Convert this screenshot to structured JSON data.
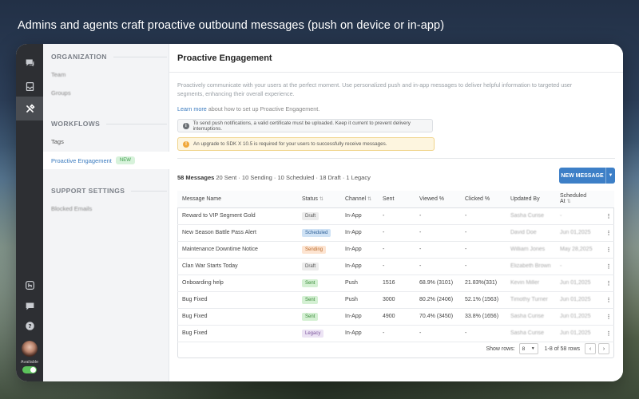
{
  "caption": "Admins and agents craft proactive outbound messages (push on device or in-app)",
  "rail": {
    "status_label": "Available"
  },
  "nav": {
    "organization_heading": "ORGANIZATION",
    "team": "Team",
    "groups": "Groups",
    "workflows_heading": "WORKFLOWS",
    "tags": "Tags",
    "proactive": "Proactive Engagement",
    "new_badge": "NEW",
    "support_heading": "SUPPORT SETTINGS",
    "blocked": "Blocked Emails"
  },
  "main": {
    "title": "Proactive Engagement",
    "intro": "Proactively communicate with your users at the perfect moment. Use personalized push and in-app messages to deliver helpful information to targeted user segments, enhancing their overall experience.",
    "learn_link": "Learn more",
    "learn_rest": " about how to set up Proactive Engagement.",
    "notice_info": "To send push notifications, a valid certificate must be uploaded. Keep it current to prevent delivery interruptions.",
    "notice_warn": "An upgrade to SDK X 10.5 is required for your users to successfully receive messages.",
    "summary_count": "58 Messages",
    "summary_rest": " 20 Sent · 10 Sending · 10 Scheduled · 18 Draft · 1 Legacy",
    "new_message": "NEW MESSAGE"
  },
  "table": {
    "headers": [
      "Message Name",
      "Status",
      "Channel",
      "Sent",
      "Viewed %",
      "Clicked %",
      "Updated By",
      "Scheduled At"
    ],
    "rows": [
      {
        "name": "Reward to VIP Segment Gold",
        "status": "Draft",
        "channel": "In-App",
        "sent": "-",
        "viewed": "-",
        "clicked": "-",
        "by": "Sasha Curise",
        "at": "-"
      },
      {
        "name": "New Season Battle Pass Alert",
        "status": "Scheduled",
        "channel": "In-App",
        "sent": "-",
        "viewed": "-",
        "clicked": "-",
        "by": "David Doe",
        "at": "Jun 01,2025"
      },
      {
        "name": "Maintenance Downtime Notice",
        "status": "Sending",
        "channel": "In-App",
        "sent": "-",
        "viewed": "-",
        "clicked": "-",
        "by": "William Jones",
        "at": "May 28,2025"
      },
      {
        "name": "Clan War Starts Today",
        "status": "Draft",
        "channel": "In-App",
        "sent": "-",
        "viewed": "-",
        "clicked": "-",
        "by": "Elizabeth Brown",
        "at": "-"
      },
      {
        "name": "Onboarding help",
        "status": "Sent",
        "channel": "Push",
        "sent": "1516",
        "viewed": "68.9% (3101)",
        "clicked": "21.83%(331)",
        "by": "Kevin Miller",
        "at": "Jun 01,2025"
      },
      {
        "name": "Bug Fixed",
        "status": "Sent",
        "channel": "Push",
        "sent": "3000",
        "viewed": "80.2% (2406)",
        "clicked": "52.1% (1563)",
        "by": "Timothy Turner",
        "at": "Jun 01,2025"
      },
      {
        "name": "Bug Fixed",
        "status": "Sent",
        "channel": "In-App",
        "sent": "4900",
        "viewed": "70.4% (3450)",
        "clicked": "33.8% (1656)",
        "by": "Sasha Curise",
        "at": "Jun 01,2025"
      },
      {
        "name": "Bug Fixed",
        "status": "Legacy",
        "channel": "In-App",
        "sent": "-",
        "viewed": "-",
        "clicked": "-",
        "by": "Sasha Curise",
        "at": "Jun 01,2025"
      }
    ]
  },
  "footer": {
    "show_rows_label": "Show rows:",
    "rows_value": "8",
    "range": "1-8 of 58 rows"
  }
}
